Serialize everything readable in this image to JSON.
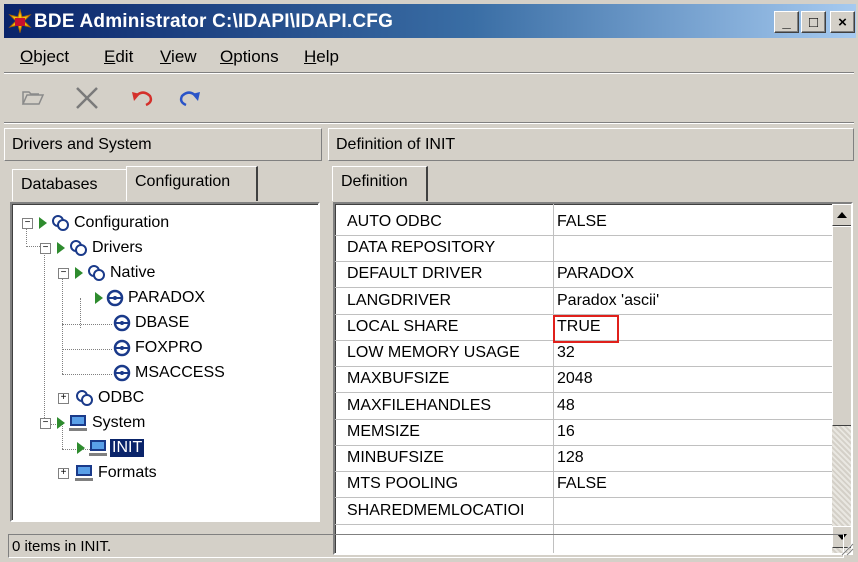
{
  "window": {
    "title": "BDE Administrator  C:\\IDAPI\\IDAPI.CFG",
    "minimize_label": "_",
    "maximize_label": "□",
    "close_label": "×"
  },
  "menu": {
    "items": [
      {
        "first": "O",
        "rest": "bject"
      },
      {
        "first": "E",
        "rest": "dit"
      },
      {
        "first": "V",
        "rest": "iew"
      },
      {
        "first": "O",
        "rest": "ptions"
      },
      {
        "first": "H",
        "rest": "elp"
      }
    ]
  },
  "toolbar": {
    "icons": [
      "open-folder-icon",
      "delete-x-icon",
      "undo-icon",
      "redo-icon"
    ]
  },
  "left_panel": {
    "header": "Drivers and System",
    "tabs": [
      "Databases",
      "Configuration"
    ],
    "active_tab": "Configuration"
  },
  "tree": {
    "nodes": [
      {
        "label": "Configuration",
        "icon": "config-icon",
        "expander": "−"
      },
      {
        "label": "Drivers",
        "icon": "config-icon",
        "expander": "−"
      },
      {
        "label": "Native",
        "icon": "config-icon",
        "expander": "−"
      },
      {
        "label": "PARADOX",
        "icon": "driver-wheel-icon"
      },
      {
        "label": "DBASE",
        "icon": "driver-wheel-icon"
      },
      {
        "label": "FOXPRO",
        "icon": "driver-wheel-icon"
      },
      {
        "label": "MSACCESS",
        "icon": "driver-wheel-icon"
      },
      {
        "label": "ODBC",
        "icon": "config-icon",
        "expander": "+"
      },
      {
        "label": "System",
        "icon": "computer-icon",
        "expander": "−"
      },
      {
        "label": "INIT",
        "icon": "computer-icon",
        "selected": true
      },
      {
        "label": "Formats",
        "icon": "computer-icon",
        "expander": "+"
      }
    ]
  },
  "right_panel": {
    "header": "Definition of INIT",
    "tabs": [
      "Definition"
    ]
  },
  "definition": {
    "rows": [
      {
        "name": "AUTO ODBC",
        "value": "FALSE"
      },
      {
        "name": "DATA REPOSITORY",
        "value": ""
      },
      {
        "name": "DEFAULT DRIVER",
        "value": "PARADOX"
      },
      {
        "name": "LANGDRIVER",
        "value": "Paradox 'ascii'"
      },
      {
        "name": "LOCAL SHARE",
        "value": "TRUE",
        "highlighted": true
      },
      {
        "name": "LOW MEMORY USAGE",
        "value": "32"
      },
      {
        "name": "MAXBUFSIZE",
        "value": "2048"
      },
      {
        "name": "MAXFILEHANDLES",
        "value": "48"
      },
      {
        "name": "MEMSIZE",
        "value": "16"
      },
      {
        "name": "MINBUFSIZE",
        "value": "128"
      },
      {
        "name": "MTS POOLING",
        "value": "FALSE"
      },
      {
        "name": "SHAREDMEMLOCATIOI",
        "value": ""
      }
    ],
    "highlight_color": "#e0201b"
  },
  "status": {
    "text": "0 items in INIT."
  },
  "colors": {
    "title_gradient_start": "#0a246a",
    "title_gradient_end": "#a6caf0",
    "selection": "#0a246a",
    "tree_arrow": "#2e8b2e"
  }
}
